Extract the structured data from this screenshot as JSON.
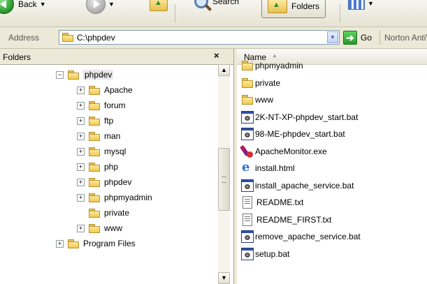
{
  "toolbar": {
    "back_label": "Back",
    "search_label": "Search",
    "folders_label": "Folders"
  },
  "address": {
    "label": "Address",
    "path": "C:\\phpdev",
    "go_label": "Go",
    "norton_label": "Norton AntiVirus"
  },
  "folders_pane": {
    "title": "Folders",
    "close": "×",
    "tree": [
      {
        "label": "phpdev",
        "expander": "−",
        "level": 0,
        "selected": true
      },
      {
        "label": "Apache",
        "expander": "+",
        "level": 1
      },
      {
        "label": "forum",
        "expander": "+",
        "level": 1
      },
      {
        "label": "ftp",
        "expander": "+",
        "level": 1
      },
      {
        "label": "man",
        "expander": "+",
        "level": 1
      },
      {
        "label": "mysql",
        "expander": "+",
        "level": 1
      },
      {
        "label": "php",
        "expander": "+",
        "level": 1
      },
      {
        "label": "phpdev",
        "expander": "+",
        "level": 1
      },
      {
        "label": "phpmyadmin",
        "expander": "+",
        "level": 1
      },
      {
        "label": "private",
        "expander": "",
        "level": 1
      },
      {
        "label": "www",
        "expander": "+",
        "level": 1
      },
      {
        "label": "Program Files",
        "expander": "+",
        "level": 0
      }
    ]
  },
  "file_list": {
    "column_name": "Name",
    "files": [
      {
        "name": "phpmyadmin",
        "icon": "folder-icon"
      },
      {
        "name": "private",
        "icon": "folder-icon"
      },
      {
        "name": "www",
        "icon": "folder-icon"
      },
      {
        "name": "2K-NT-XP-phpdev_start.bat",
        "icon": "batch-file-icon"
      },
      {
        "name": "98-ME-phpdev_start.bat",
        "icon": "batch-file-icon"
      },
      {
        "name": "ApacheMonitor.exe",
        "icon": "apache-feather-icon"
      },
      {
        "name": "install.html",
        "icon": "internet-explorer-icon"
      },
      {
        "name": "install_apache_service.bat",
        "icon": "batch-file-icon"
      },
      {
        "name": "README.txt",
        "icon": "text-file-icon"
      },
      {
        "name": "README_FIRST.txt",
        "icon": "text-file-icon"
      },
      {
        "name": "remove_apache_service.bat",
        "icon": "batch-file-icon"
      },
      {
        "name": "setup.bat",
        "icon": "batch-file-icon"
      }
    ]
  }
}
